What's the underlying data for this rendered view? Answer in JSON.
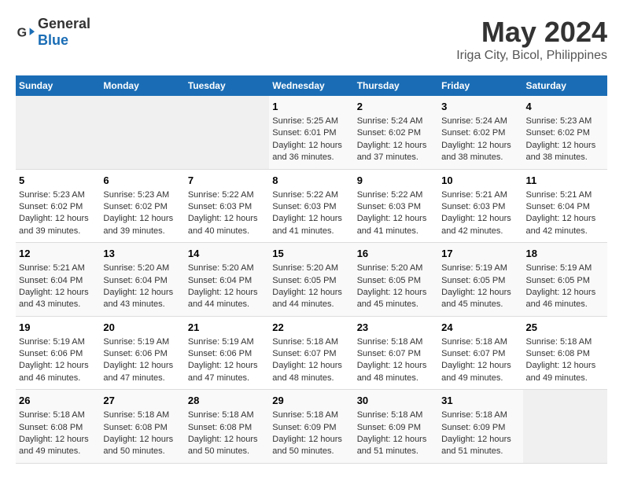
{
  "header": {
    "logo_general": "General",
    "logo_blue": "Blue",
    "title": "May 2024",
    "subtitle": "Iriga City, Bicol, Philippines"
  },
  "calendar": {
    "days_of_week": [
      "Sunday",
      "Monday",
      "Tuesday",
      "Wednesday",
      "Thursday",
      "Friday",
      "Saturday"
    ],
    "weeks": [
      {
        "days": [
          {
            "number": "",
            "empty": true
          },
          {
            "number": "",
            "empty": true
          },
          {
            "number": "",
            "empty": true
          },
          {
            "number": "1",
            "sunrise": "5:25 AM",
            "sunset": "6:01 PM",
            "daylight": "12 hours and 36 minutes."
          },
          {
            "number": "2",
            "sunrise": "5:24 AM",
            "sunset": "6:02 PM",
            "daylight": "12 hours and 37 minutes."
          },
          {
            "number": "3",
            "sunrise": "5:24 AM",
            "sunset": "6:02 PM",
            "daylight": "12 hours and 38 minutes."
          },
          {
            "number": "4",
            "sunrise": "5:23 AM",
            "sunset": "6:02 PM",
            "daylight": "12 hours and 38 minutes."
          }
        ]
      },
      {
        "days": [
          {
            "number": "5",
            "sunrise": "5:23 AM",
            "sunset": "6:02 PM",
            "daylight": "12 hours and 39 minutes."
          },
          {
            "number": "6",
            "sunrise": "5:23 AM",
            "sunset": "6:02 PM",
            "daylight": "12 hours and 39 minutes."
          },
          {
            "number": "7",
            "sunrise": "5:22 AM",
            "sunset": "6:03 PM",
            "daylight": "12 hours and 40 minutes."
          },
          {
            "number": "8",
            "sunrise": "5:22 AM",
            "sunset": "6:03 PM",
            "daylight": "12 hours and 41 minutes."
          },
          {
            "number": "9",
            "sunrise": "5:22 AM",
            "sunset": "6:03 PM",
            "daylight": "12 hours and 41 minutes."
          },
          {
            "number": "10",
            "sunrise": "5:21 AM",
            "sunset": "6:03 PM",
            "daylight": "12 hours and 42 minutes."
          },
          {
            "number": "11",
            "sunrise": "5:21 AM",
            "sunset": "6:04 PM",
            "daylight": "12 hours and 42 minutes."
          }
        ]
      },
      {
        "days": [
          {
            "number": "12",
            "sunrise": "5:21 AM",
            "sunset": "6:04 PM",
            "daylight": "12 hours and 43 minutes."
          },
          {
            "number": "13",
            "sunrise": "5:20 AM",
            "sunset": "6:04 PM",
            "daylight": "12 hours and 43 minutes."
          },
          {
            "number": "14",
            "sunrise": "5:20 AM",
            "sunset": "6:04 PM",
            "daylight": "12 hours and 44 minutes."
          },
          {
            "number": "15",
            "sunrise": "5:20 AM",
            "sunset": "6:05 PM",
            "daylight": "12 hours and 44 minutes."
          },
          {
            "number": "16",
            "sunrise": "5:20 AM",
            "sunset": "6:05 PM",
            "daylight": "12 hours and 45 minutes."
          },
          {
            "number": "17",
            "sunrise": "5:19 AM",
            "sunset": "6:05 PM",
            "daylight": "12 hours and 45 minutes."
          },
          {
            "number": "18",
            "sunrise": "5:19 AM",
            "sunset": "6:05 PM",
            "daylight": "12 hours and 46 minutes."
          }
        ]
      },
      {
        "days": [
          {
            "number": "19",
            "sunrise": "5:19 AM",
            "sunset": "6:06 PM",
            "daylight": "12 hours and 46 minutes."
          },
          {
            "number": "20",
            "sunrise": "5:19 AM",
            "sunset": "6:06 PM",
            "daylight": "12 hours and 47 minutes."
          },
          {
            "number": "21",
            "sunrise": "5:19 AM",
            "sunset": "6:06 PM",
            "daylight": "12 hours and 47 minutes."
          },
          {
            "number": "22",
            "sunrise": "5:18 AM",
            "sunset": "6:07 PM",
            "daylight": "12 hours and 48 minutes."
          },
          {
            "number": "23",
            "sunrise": "5:18 AM",
            "sunset": "6:07 PM",
            "daylight": "12 hours and 48 minutes."
          },
          {
            "number": "24",
            "sunrise": "5:18 AM",
            "sunset": "6:07 PM",
            "daylight": "12 hours and 49 minutes."
          },
          {
            "number": "25",
            "sunrise": "5:18 AM",
            "sunset": "6:08 PM",
            "daylight": "12 hours and 49 minutes."
          }
        ]
      },
      {
        "days": [
          {
            "number": "26",
            "sunrise": "5:18 AM",
            "sunset": "6:08 PM",
            "daylight": "12 hours and 49 minutes."
          },
          {
            "number": "27",
            "sunrise": "5:18 AM",
            "sunset": "6:08 PM",
            "daylight": "12 hours and 50 minutes."
          },
          {
            "number": "28",
            "sunrise": "5:18 AM",
            "sunset": "6:08 PM",
            "daylight": "12 hours and 50 minutes."
          },
          {
            "number": "29",
            "sunrise": "5:18 AM",
            "sunset": "6:09 PM",
            "daylight": "12 hours and 50 minutes."
          },
          {
            "number": "30",
            "sunrise": "5:18 AM",
            "sunset": "6:09 PM",
            "daylight": "12 hours and 51 minutes."
          },
          {
            "number": "31",
            "sunrise": "5:18 AM",
            "sunset": "6:09 PM",
            "daylight": "12 hours and 51 minutes."
          },
          {
            "number": "",
            "empty": true
          }
        ]
      }
    ],
    "sunrise_label": "Sunrise:",
    "sunset_label": "Sunset:",
    "daylight_label": "Daylight:"
  }
}
